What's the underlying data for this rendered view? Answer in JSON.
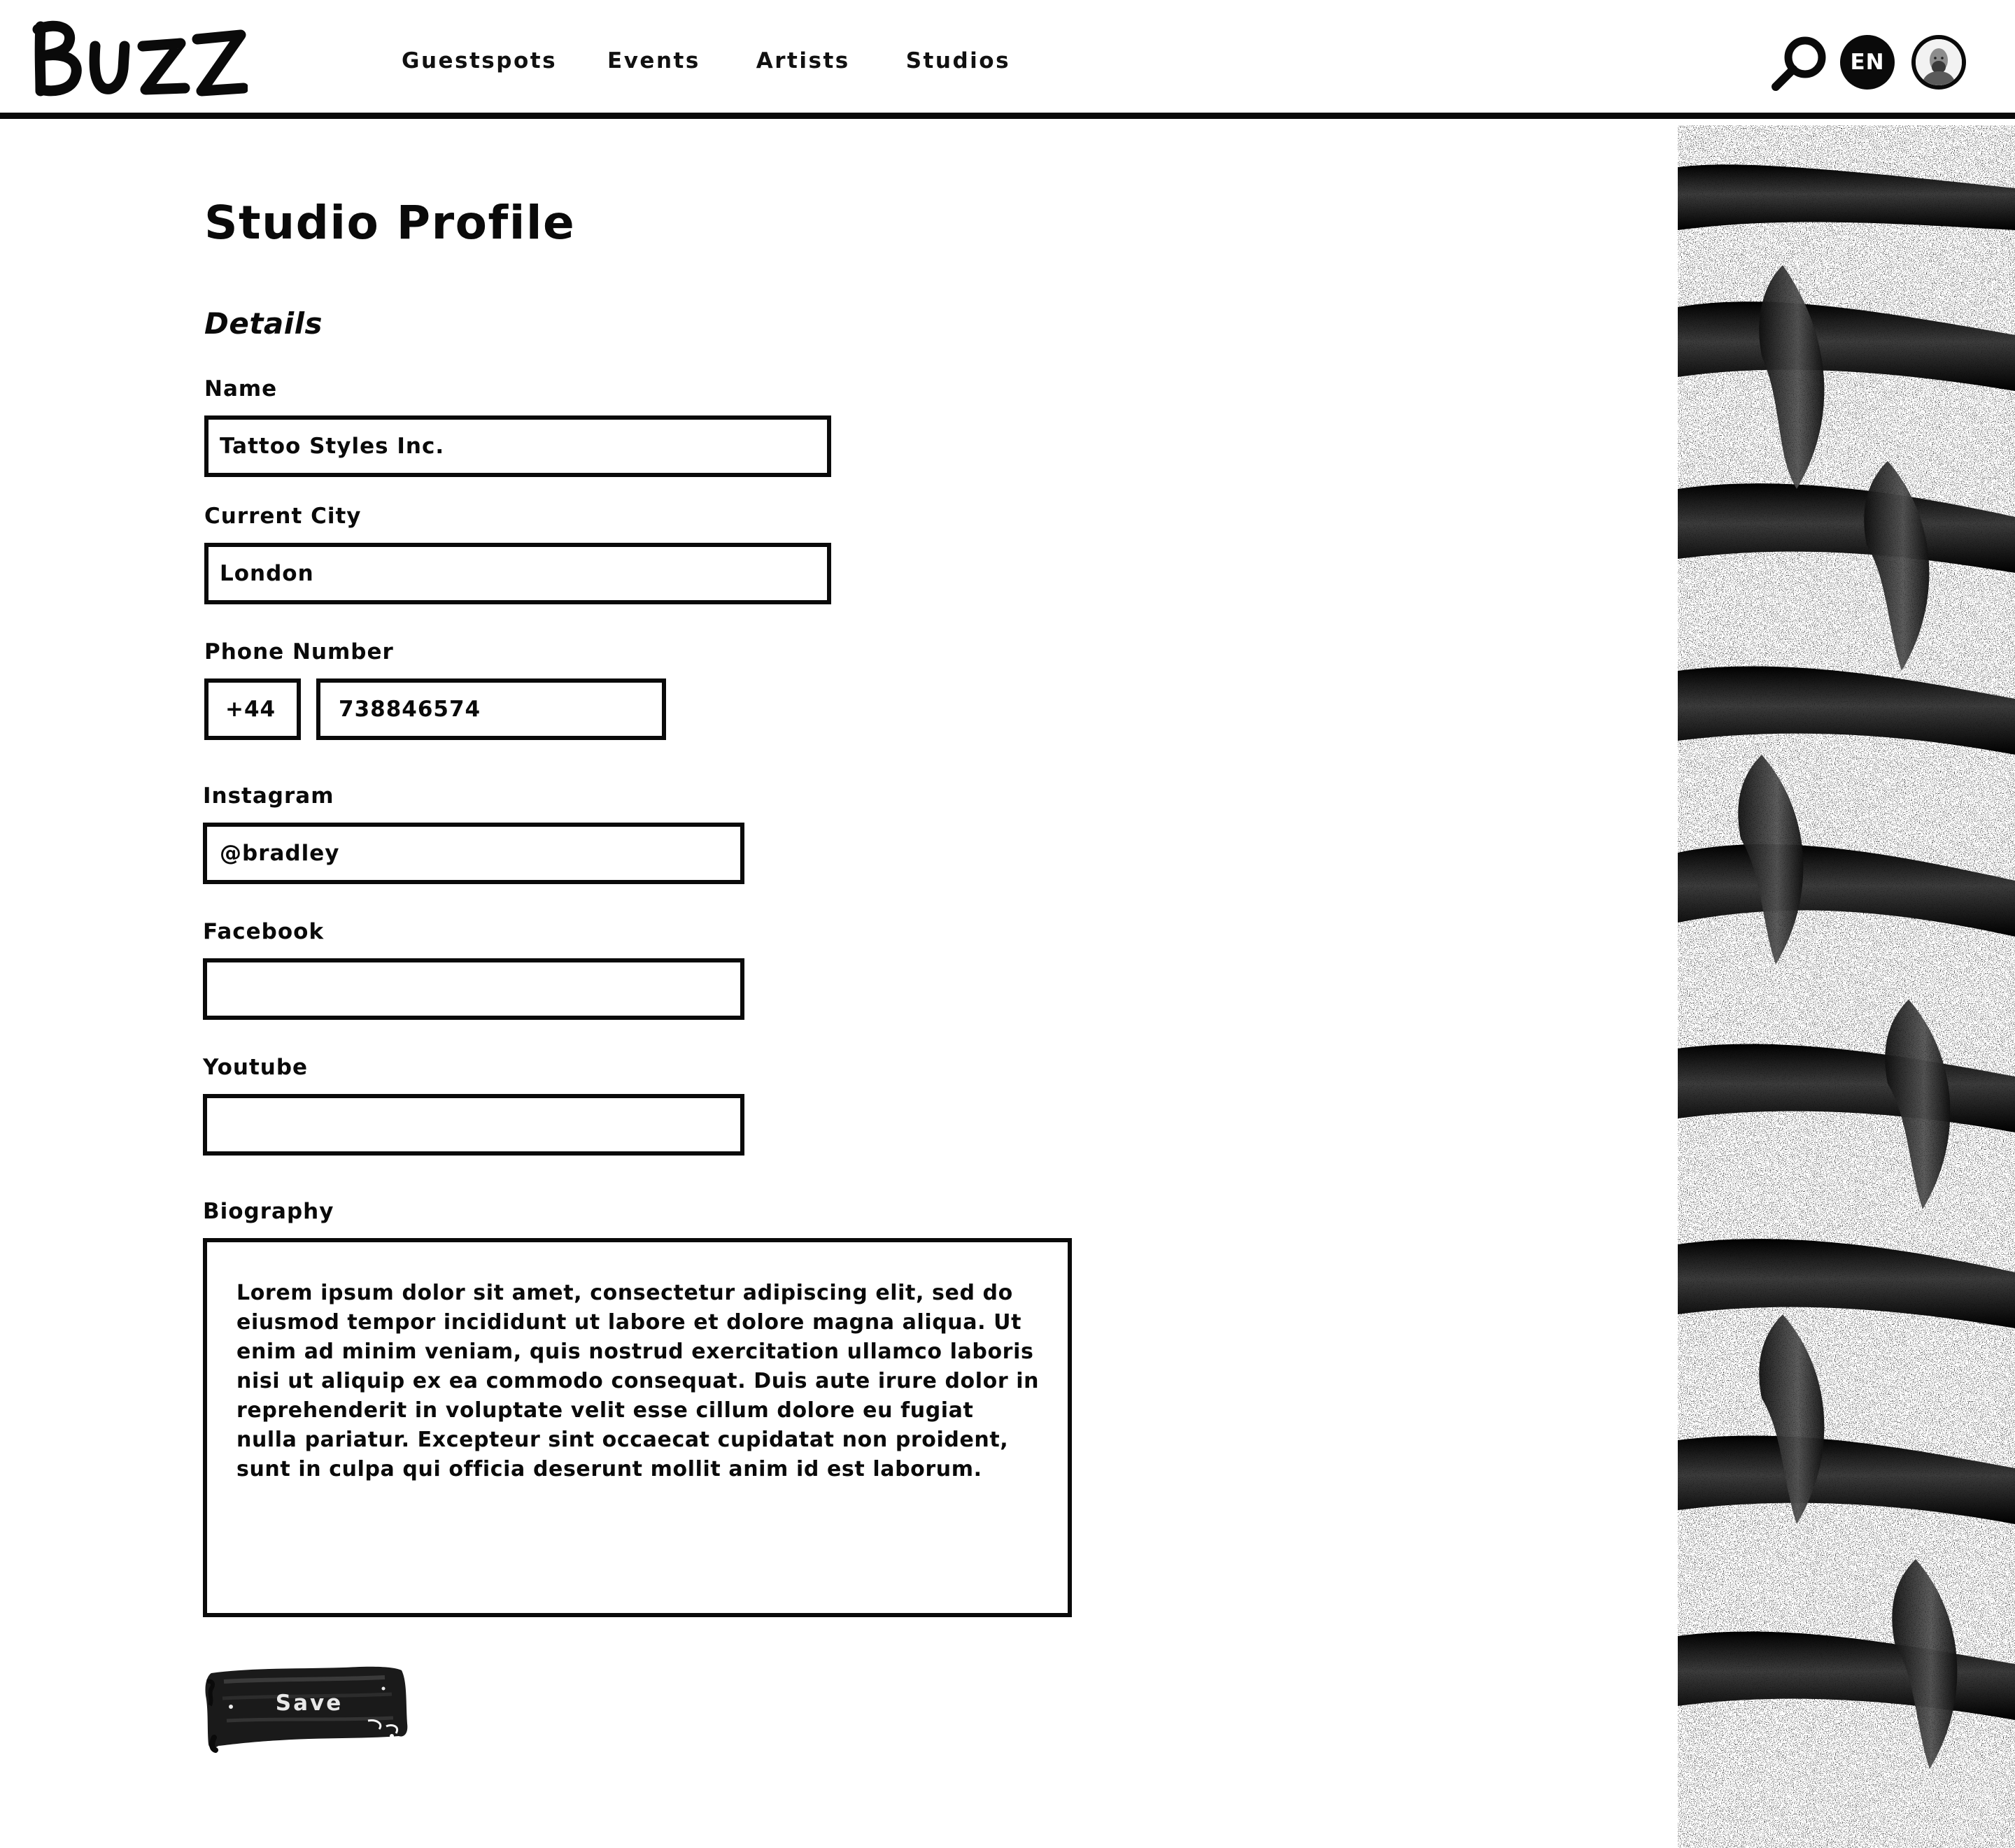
{
  "brand": {
    "logo_text": "BUZZ"
  },
  "nav": {
    "items": [
      {
        "label": "Guestspots"
      },
      {
        "label": "Events"
      },
      {
        "label": "Artists"
      },
      {
        "label": "Studios"
      }
    ]
  },
  "header": {
    "language": "EN"
  },
  "page": {
    "title": "Studio Profile",
    "section_title": "Details"
  },
  "form": {
    "name": {
      "label": "Name",
      "value": "Tattoo Styles Inc."
    },
    "city": {
      "label": "Current City",
      "value": "London"
    },
    "phone": {
      "label": "Phone Number",
      "country_code": "+44",
      "number": "738846574"
    },
    "instagram": {
      "label": "Instagram",
      "value": "@bradley"
    },
    "facebook": {
      "label": "Facebook",
      "value": ""
    },
    "youtube": {
      "label": "Youtube",
      "value": ""
    },
    "biography": {
      "label": "Biography",
      "value": "Lorem ipsum dolor sit amet, consectetur adipiscing elit, sed do eiusmod tempor incididunt ut labore et dolore magna aliqua. Ut enim ad minim veniam, quis nostrud exercitation ullamco laboris nisi ut aliquip ex ea commodo consequat. Duis aute irure dolor in reprehenderit in voluptate velit esse cillum dolore eu fugiat nulla pariatur. Excepteur sint occaecat cupidatat non proident, sunt in culpa qui officia deserunt mollit anim id est laborum."
    },
    "save_label": "Save"
  },
  "theme": {
    "ink": "#0a0a0a",
    "background": "#ffffff"
  },
  "icons": {
    "search": "search-icon",
    "avatar": "user-avatar"
  }
}
